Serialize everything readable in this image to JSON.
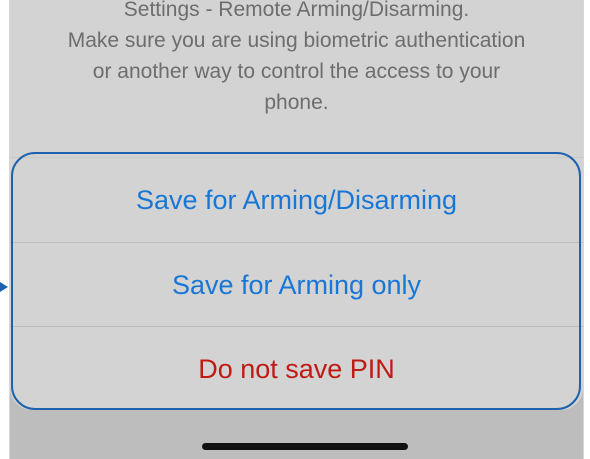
{
  "alert": {
    "message_lines": [
      "Settings - Remote Arming/Disarming.",
      "Make sure you are using biometric authentication",
      "or another way to control the access to your",
      "phone."
    ]
  },
  "actions": [
    {
      "label": "Save for Arming/Disarming",
      "color": "#1877d6"
    },
    {
      "label": "Save for Arming only",
      "color": "#1877d6"
    },
    {
      "label": "Do not save PIN",
      "color": "#bf1b14"
    }
  ],
  "annotation": {
    "highlight_color": "#1d62ac",
    "arrow_icon": "pointer-arrow-icon"
  }
}
